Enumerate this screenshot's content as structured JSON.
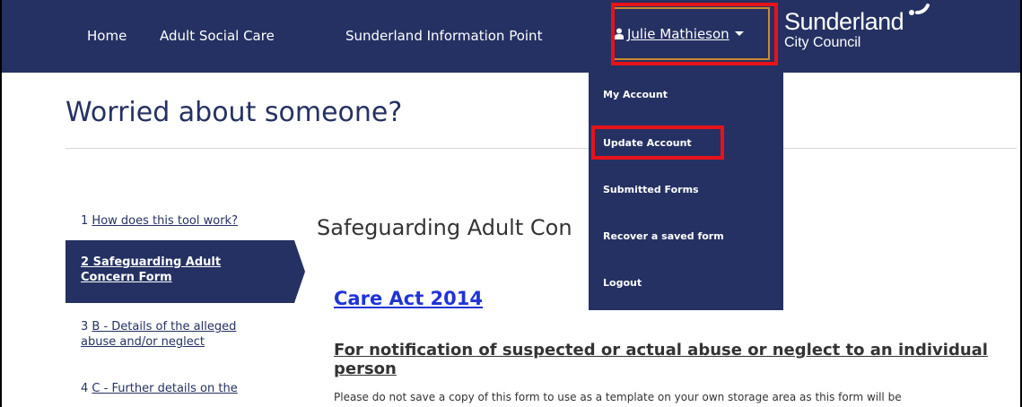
{
  "nav": {
    "home": "Home",
    "adult_social_care": "Adult Social Care",
    "info_point": "Sunderland Information Point",
    "user_name": "Julie Mathieson"
  },
  "logo": {
    "line1": "Sunderland",
    "line2": "City Council"
  },
  "page_title": "Worried about someone?",
  "steps": {
    "step1_num": "1",
    "step1_label": "How does this tool work?",
    "step2_num": "2",
    "step2_label_line1": "Safeguarding Adult",
    "step2_label_line2": "Concern Form",
    "step3_num": "3",
    "step3_label_line1": "B - Details of the alleged",
    "step3_label_line2": "abuse and/or neglect",
    "step4_num": "4",
    "step4_label": "C - Further details on the"
  },
  "main": {
    "section_heading": "Safeguarding Adult Con",
    "care_act": "Care Act 2014",
    "notification": "For notification of suspected or actual abuse or neglect to an individual person",
    "notice": "Please do not save a copy of this form to use as a template on your own storage area as this form will be"
  },
  "dropdown": {
    "items": [
      "My Account",
      "Update Account",
      "Submitted Forms",
      "Recover a saved form",
      "Logout"
    ]
  },
  "colors": {
    "navy": "#253162",
    "highlight": "#e8121b",
    "link": "#1f34d6",
    "button_border": "#c98b2f"
  }
}
